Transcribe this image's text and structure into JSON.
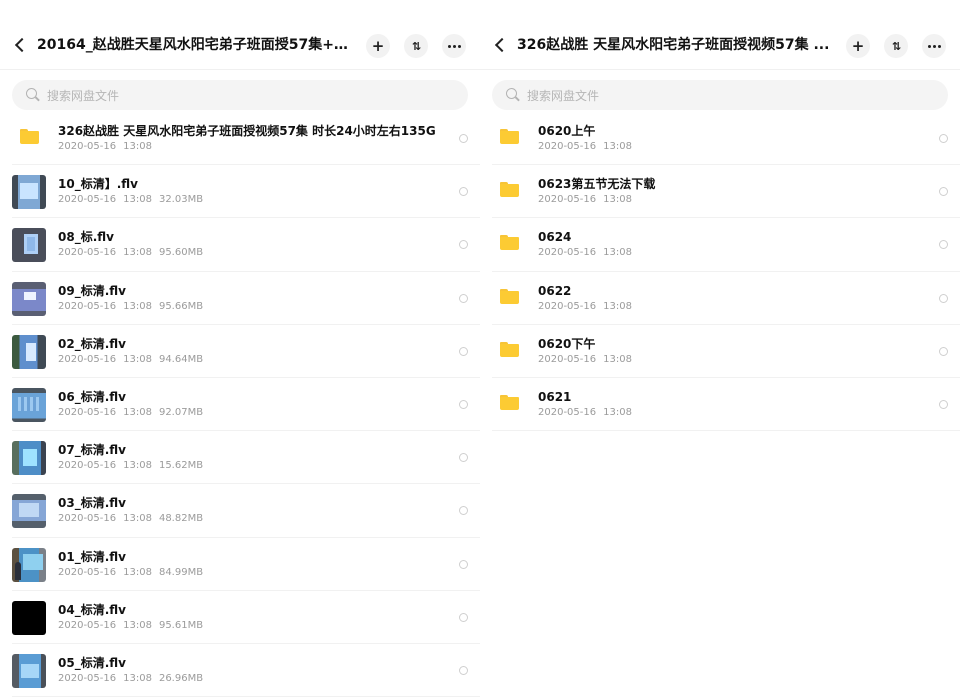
{
  "left_pane": {
    "title": "20164_赵战胜天星风水阳宅弟子班面授57集+前...",
    "search_placeholder": "搜索网盘文件",
    "items": [
      {
        "type": "folder",
        "name": "326赵战胜 天星风水阳宅弟子班面授视频57集 时长24小时左右135G",
        "date": "2020-05-16",
        "time": "13:08",
        "size": ""
      },
      {
        "type": "video",
        "thumb": "v-a",
        "name": "10_标清】.flv",
        "date": "2020-05-16",
        "time": "13:08",
        "size": "32.03MB"
      },
      {
        "type": "video",
        "thumb": "v-b",
        "name": "08_标.flv",
        "date": "2020-05-16",
        "time": "13:08",
        "size": "95.60MB"
      },
      {
        "type": "video",
        "thumb": "v-c",
        "name": "09_标清.flv",
        "date": "2020-05-16",
        "time": "13:08",
        "size": "95.66MB"
      },
      {
        "type": "video",
        "thumb": "v-d",
        "name": "02_标清.flv",
        "date": "2020-05-16",
        "time": "13:08",
        "size": "94.64MB"
      },
      {
        "type": "video",
        "thumb": "v-e",
        "name": "06_标清.flv",
        "date": "2020-05-16",
        "time": "13:08",
        "size": "92.07MB"
      },
      {
        "type": "video",
        "thumb": "v-f",
        "name": "07_标清.flv",
        "date": "2020-05-16",
        "time": "13:08",
        "size": "15.62MB"
      },
      {
        "type": "video",
        "thumb": "v-g",
        "name": "03_标清.flv",
        "date": "2020-05-16",
        "time": "13:08",
        "size": "48.82MB"
      },
      {
        "type": "video",
        "thumb": "v-h",
        "name": "01_标清.flv",
        "date": "2020-05-16",
        "time": "13:08",
        "size": "84.99MB"
      },
      {
        "type": "video",
        "thumb": "v-i",
        "name": "04_标清.flv",
        "date": "2020-05-16",
        "time": "13:08",
        "size": "95.61MB"
      },
      {
        "type": "video",
        "thumb": "v-j",
        "name": "05_标清.flv",
        "date": "2020-05-16",
        "time": "13:08",
        "size": "26.96MB"
      }
    ]
  },
  "right_pane": {
    "title": "326赵战胜 天星风水阳宅弟子班面授视频57集 ...",
    "search_placeholder": "搜索网盘文件",
    "items": [
      {
        "type": "folder",
        "name": "0620上午",
        "date": "2020-05-16",
        "time": "13:08",
        "size": ""
      },
      {
        "type": "folder",
        "name": "0623第五节无法下载",
        "date": "2020-05-16",
        "time": "13:08",
        "size": ""
      },
      {
        "type": "folder",
        "name": "0624",
        "date": "2020-05-16",
        "time": "13:08",
        "size": ""
      },
      {
        "type": "folder",
        "name": "0622",
        "date": "2020-05-16",
        "time": "13:08",
        "size": ""
      },
      {
        "type": "folder",
        "name": "0620下午",
        "date": "2020-05-16",
        "time": "13:08",
        "size": ""
      },
      {
        "type": "folder",
        "name": "0621",
        "date": "2020-05-16",
        "time": "13:08",
        "size": ""
      }
    ]
  },
  "header_buttons": {
    "add": "+",
    "sort": "⇅"
  },
  "colors": {
    "folder": "#fccb33",
    "meta_text": "#9b9b9b",
    "search_bg": "#f4f4f4"
  }
}
